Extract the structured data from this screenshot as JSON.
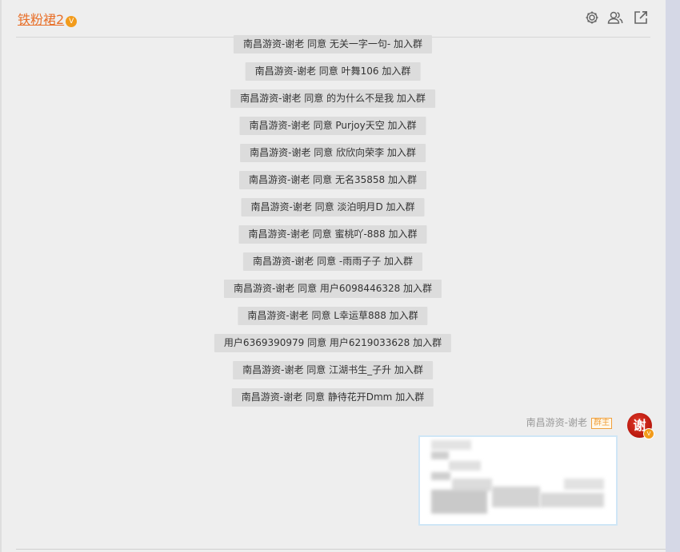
{
  "header": {
    "title": "铁粉裙2",
    "vip_badge": "V",
    "icons": [
      "settings-icon",
      "members-icon",
      "popout-icon"
    ]
  },
  "system_messages": [
    "南昌游资-谢老 同意 无关一字一句- 加入群",
    "南昌游资-谢老 同意 叶舞106 加入群",
    "南昌游资-谢老 同意 的为什么不是我 加入群",
    "南昌游资-谢老 同意 Purjoy天空 加入群",
    "南昌游资-谢老 同意 欣欣向荣李 加入群",
    "南昌游资-谢老 同意 无名35858 加入群",
    "南昌游资-谢老 同意 淡泊明月D 加入群",
    "南昌游资-谢老 同意 蜜桃吖-888 加入群",
    "南昌游资-谢老 同意 -雨雨子子 加入群",
    "南昌游资-谢老 同意 用户6098446328 加入群",
    "南昌游资-谢老 同意 L幸运草888 加入群",
    "用户6369390979 同意 用户6219033628 加入群",
    "南昌游资-谢老 同意 江湖书生_子升 加入群",
    "南昌游资-谢老 同意 静待花开Dmm 加入群"
  ],
  "last_message": {
    "sender": "南昌游资-谢老",
    "role": "群主",
    "avatar_text": "谢",
    "avatar_badge": "V"
  },
  "colors": {
    "accent": "#e8702a",
    "vip": "#f29b1b",
    "background": "#eeeeee",
    "system_bubble": "#dcdcdc"
  }
}
